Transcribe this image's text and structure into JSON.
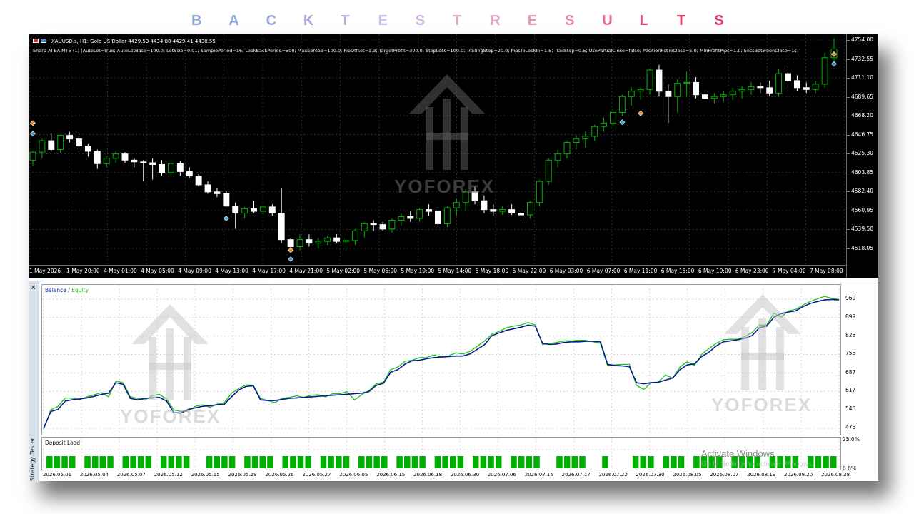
{
  "heading": {
    "letters": [
      {
        "char": "B",
        "color": "#8fa8d4"
      },
      {
        "char": "A",
        "color": "#8fa8d4"
      },
      {
        "char": "C",
        "color": "#95a9de"
      },
      {
        "char": "K",
        "color": "#a7a8df"
      },
      {
        "char": "T",
        "color": "#b6b1e2"
      },
      {
        "char": "E",
        "color": "#c2c3e8"
      },
      {
        "char": "S",
        "color": "#ccb7e4"
      },
      {
        "char": "T",
        "color": "#e7a8c5"
      },
      {
        "char": "R",
        "color": "#e5a9c8"
      },
      {
        "char": "E",
        "color": "#e79ab8"
      },
      {
        "char": "S",
        "color": "#e78aa8"
      },
      {
        "char": "U",
        "color": "#e86a8f"
      },
      {
        "char": "L",
        "color": "#e9537a"
      },
      {
        "char": "T",
        "color": "#e84167"
      },
      {
        "char": "S",
        "color": "#ea3661"
      }
    ]
  },
  "chart": {
    "symbol_line": "XAUUSD.s, H1:  Gold US Dollar  4429.53 4434.88 4429.41 4430.55",
    "ea_params": "Sharp AI EA MT5 (1) [AutoLot=true; AutoLotBase=100.0; LotSize=0.01; SamplePeriod=16; LookBackPeriod=500; MaxSpread=100.0; PipOffset=1.3; TargetProfit=300.0; StopLoss=100.0; TrailingStop=20.0; PipsToLockIn=1.5; TrailStep=0.5; UsePartialClose=false; PositionPctToClose=5.0; MinProfitPips=1.0; SecsBetweenClose=1s]",
    "price_labels": [
      "4754.00",
      "4732.55",
      "4711.10",
      "4689.65",
      "4668.20",
      "4646.75",
      "4625.30",
      "4603.85",
      "4582.40",
      "4560.95",
      "4539.50",
      "4518.05"
    ],
    "time_labels": [
      "1 May 2026",
      "1 May 20:00",
      "4 May 01:00",
      "4 May 05:00",
      "4 May 09:00",
      "4 May 13:00",
      "4 May 17:00",
      "4 May 21:00",
      "5 May 02:00",
      "5 May 06:00",
      "5 May 10:00",
      "5 May 14:00",
      "5 May 18:00",
      "5 May 22:00",
      "6 May 03:00",
      "6 May 07:00",
      "6 May 11:00",
      "6 May 15:00",
      "6 May 19:00",
      "6 May 23:00",
      "7 May 04:00",
      "7 May 08:00"
    ],
    "candles": [
      [
        4618,
        4628,
        4612,
        4627
      ],
      [
        4627,
        4642,
        4620,
        4640
      ],
      [
        4640,
        4648,
        4628,
        4630
      ],
      [
        4630,
        4647,
        4626,
        4646
      ],
      [
        4646,
        4650,
        4638,
        4642
      ],
      [
        4642,
        4645,
        4630,
        4634
      ],
      [
        4634,
        4636,
        4622,
        4628
      ],
      [
        4628,
        4630,
        4608,
        4614
      ],
      [
        4614,
        4622,
        4610,
        4620
      ],
      [
        4620,
        4628,
        4615,
        4625
      ],
      [
        4625,
        4627,
        4615,
        4618
      ],
      [
        4618,
        4620,
        4610,
        4616
      ],
      [
        4616,
        4618,
        4594,
        4615
      ],
      [
        4615,
        4620,
        4596,
        4613
      ],
      [
        4613,
        4618,
        4600,
        4604
      ],
      [
        4604,
        4616,
        4600,
        4614
      ],
      [
        4614,
        4617,
        4600,
        4605
      ],
      [
        4605,
        4610,
        4598,
        4600
      ],
      [
        4600,
        4602,
        4588,
        4590
      ],
      [
        4590,
        4594,
        4580,
        4582
      ],
      [
        4582,
        4586,
        4576,
        4580
      ],
      [
        4580,
        4583,
        4565,
        4566
      ],
      [
        4566,
        4570,
        4540,
        4558
      ],
      [
        4558,
        4565,
        4552,
        4563
      ],
      [
        4563,
        4572,
        4558,
        4560
      ],
      [
        4560,
        4566,
        4556,
        4565
      ],
      [
        4565,
        4568,
        4555,
        4558
      ],
      [
        4558,
        4586,
        4524,
        4528
      ],
      [
        4528,
        4530,
        4514,
        4520
      ],
      [
        4520,
        4534,
        4516,
        4528
      ],
      [
        4528,
        4534,
        4520,
        4524
      ],
      [
        4524,
        4530,
        4518,
        4526
      ],
      [
        4526,
        4532,
        4522,
        4530
      ],
      [
        4530,
        4534,
        4524,
        4526
      ],
      [
        4526,
        4530,
        4520,
        4527
      ],
      [
        4527,
        4540,
        4522,
        4538
      ],
      [
        4538,
        4548,
        4530,
        4546
      ],
      [
        4546,
        4550,
        4538,
        4545
      ],
      [
        4545,
        4548,
        4538,
        4540
      ],
      [
        4540,
        4552,
        4536,
        4550
      ],
      [
        4550,
        4558,
        4544,
        4554
      ],
      [
        4554,
        4560,
        4548,
        4552
      ],
      [
        4552,
        4564,
        4548,
        4562
      ],
      [
        4562,
        4568,
        4555,
        4560
      ],
      [
        4560,
        4565,
        4542,
        4546
      ],
      [
        4546,
        4566,
        4542,
        4564
      ],
      [
        4564,
        4574,
        4555,
        4570
      ],
      [
        4570,
        4585,
        4560,
        4582
      ],
      [
        4582,
        4588,
        4568,
        4572
      ],
      [
        4572,
        4578,
        4558,
        4562
      ],
      [
        4562,
        4568,
        4555,
        4560
      ],
      [
        4560,
        4566,
        4556,
        4562
      ],
      [
        4562,
        4568,
        4556,
        4558
      ],
      [
        4558,
        4564,
        4552,
        4556
      ],
      [
        4556,
        4572,
        4552,
        4570
      ],
      [
        4570,
        4596,
        4566,
        4594
      ],
      [
        4594,
        4620,
        4590,
        4618
      ],
      [
        4618,
        4630,
        4610,
        4625
      ],
      [
        4625,
        4640,
        4620,
        4638
      ],
      [
        4638,
        4646,
        4630,
        4642
      ],
      [
        4642,
        4650,
        4632,
        4645
      ],
      [
        4645,
        4658,
        4640,
        4656
      ],
      [
        4656,
        4666,
        4650,
        4660
      ],
      [
        4660,
        4676,
        4655,
        4672
      ],
      [
        4672,
        4692,
        4668,
        4690
      ],
      [
        4690,
        4700,
        4680,
        4696
      ],
      [
        4696,
        4700,
        4686,
        4698
      ],
      [
        4698,
        4722,
        4692,
        4720
      ],
      [
        4720,
        4726,
        4690,
        4696
      ],
      [
        4696,
        4704,
        4660,
        4690
      ],
      [
        4690,
        4710,
        4672,
        4705
      ],
      [
        4705,
        4718,
        4690,
        4706
      ],
      [
        4706,
        4712,
        4688,
        4692
      ],
      [
        4692,
        4696,
        4684,
        4688
      ],
      [
        4688,
        4694,
        4682,
        4690
      ],
      [
        4690,
        4696,
        4684,
        4692
      ],
      [
        4692,
        4700,
        4686,
        4696
      ],
      [
        4696,
        4702,
        4688,
        4698
      ],
      [
        4698,
        4706,
        4692,
        4701
      ],
      [
        4701,
        4706,
        4694,
        4700
      ],
      [
        4700,
        4708,
        4690,
        4694
      ],
      [
        4694,
        4722,
        4690,
        4716
      ],
      [
        4716,
        4724,
        4700,
        4708
      ],
      [
        4708,
        4714,
        4696,
        4700
      ],
      [
        4700,
        4706,
        4694,
        4698
      ],
      [
        4698,
        4708,
        4694,
        4704
      ],
      [
        4704,
        4740,
        4700,
        4734
      ],
      [
        4734,
        4756,
        4728,
        4744
      ]
    ],
    "markers": [
      {
        "i": 0,
        "type": "sell",
        "price": 4660
      },
      {
        "i": 0,
        "type": "buy",
        "price": 4648
      },
      {
        "i": 21,
        "type": "buy",
        "price": 4552
      },
      {
        "i": 28,
        "type": "sell",
        "price": 4516
      },
      {
        "i": 28,
        "type": "buy",
        "price": 4506
      },
      {
        "i": 64,
        "type": "buy",
        "price": 4661
      },
      {
        "i": 66,
        "type": "sell",
        "price": 4671
      },
      {
        "i": 87,
        "type": "sell",
        "price": 4738
      },
      {
        "i": 87,
        "type": "buy",
        "price": 4727
      }
    ]
  },
  "tester": {
    "close_glyph": "×",
    "vertical_label": "Strategy Tester",
    "legend_balance": "Balance",
    "legend_sep": " / ",
    "legend_equity": "Equity",
    "equity_labels": [
      "969",
      "899",
      "828",
      "758",
      "687",
      "617",
      "546",
      "476"
    ],
    "balance": [
      476,
      540,
      548,
      580,
      585,
      588,
      592,
      598,
      605,
      610,
      650,
      644,
      590,
      585,
      590,
      592,
      594,
      580,
      536,
      534,
      548,
      554,
      560,
      562,
      566,
      568,
      596,
      622,
      636,
      638,
      584,
      582,
      582,
      586,
      590,
      592,
      594,
      596,
      598,
      600,
      602,
      604,
      606,
      608,
      610,
      616,
      640,
      648,
      690,
      700,
      722,
      734,
      736,
      742,
      746,
      748,
      750,
      752,
      752,
      760,
      778,
      796,
      830,
      840,
      850,
      856,
      862,
      870,
      866,
      800,
      796,
      798,
      804,
      806,
      806,
      808,
      808,
      806,
      720,
      716,
      714,
      712,
      650,
      646,
      650,
      652,
      660,
      668,
      700,
      718,
      722,
      750,
      766,
      790,
      806,
      810,
      814,
      820,
      830,
      860,
      866,
      900,
      914,
      920,
      924,
      940,
      952,
      960,
      966,
      968,
      966
    ],
    "equity": [
      470,
      546,
      560,
      592,
      590,
      586,
      596,
      604,
      612,
      596,
      656,
      650,
      596,
      590,
      584,
      600,
      606,
      588,
      546,
      540,
      542,
      560,
      566,
      556,
      568,
      574,
      610,
      628,
      642,
      640,
      590,
      582,
      574,
      590,
      594,
      600,
      594,
      602,
      604,
      596,
      608,
      608,
      616,
      584,
      604,
      620,
      646,
      652,
      700,
      710,
      732,
      736,
      746,
      746,
      756,
      748,
      752,
      764,
      760,
      770,
      790,
      810,
      836,
      846,
      860,
      866,
      870,
      880,
      870,
      796,
      800,
      804,
      810,
      810,
      812,
      812,
      806,
      800,
      716,
      718,
      720,
      720,
      640,
      624,
      650,
      652,
      680,
      668,
      710,
      730,
      716,
      758,
      780,
      800,
      814,
      816,
      816,
      826,
      842,
      870,
      870,
      916,
      900,
      924,
      930,
      946,
      960,
      970,
      980,
      972,
      968
    ],
    "deposit_load_title": "Deposit Load",
    "load_max_label": "25.0%",
    "load_min_label": "0.0%",
    "load_bars": [
      1,
      1,
      1,
      1,
      0,
      1,
      1,
      1,
      1,
      0,
      1,
      1,
      1,
      1,
      0,
      1,
      1,
      1,
      1,
      0,
      0,
      1,
      1,
      1,
      1,
      0,
      1,
      1,
      1,
      1,
      0,
      1,
      1,
      1,
      1,
      0,
      1,
      1,
      1,
      1,
      0,
      1,
      1,
      1,
      1,
      0,
      1,
      1,
      1,
      1,
      0,
      1,
      1,
      1,
      1,
      0,
      1,
      1,
      1,
      1,
      0,
      1,
      1,
      1,
      1,
      0,
      0,
      1,
      1,
      1,
      1,
      0,
      0,
      1,
      0,
      0,
      0,
      1,
      1,
      1,
      0,
      1,
      1,
      1,
      0,
      1,
      1,
      1,
      1,
      0,
      1,
      1,
      1,
      1,
      0,
      1,
      1,
      1,
      1,
      0,
      1,
      1,
      1,
      1
    ],
    "date_labels": [
      "2026.05.01",
      "2026.05.04",
      "2026.05.07",
      "2026.05.12",
      "2026.05.15",
      "2026.05.19",
      "2026.05.26",
      "2026.05.27",
      "2026.06.05",
      "2026.06.15",
      "2026.06.18",
      "2026.06.30",
      "2026.07.06",
      "2026.07.16",
      "2026.07.17",
      "2026.07.22",
      "2026.07.30",
      "2026.08.05",
      "2026.08.07",
      "2026.08.19",
      "2026.08.20",
      "2026.08.28"
    ]
  },
  "watermark": {
    "brand": "YOFOREX",
    "icon": "house-arrow-logo-icon"
  },
  "os_notice": {
    "title": "Activate Windows",
    "subtitle": "Go to Settings to activate Windows."
  },
  "colors": {
    "candle_up": "#00b300",
    "candle_down": "#ffffff",
    "balance_line": "#0a1a8c",
    "equity_line": "#1fbf1f",
    "load_bar": "#00b000",
    "grid_dark": "#4a4a4a",
    "sell_marker": "#f08a30",
    "buy_marker": "#3aa0d8"
  }
}
